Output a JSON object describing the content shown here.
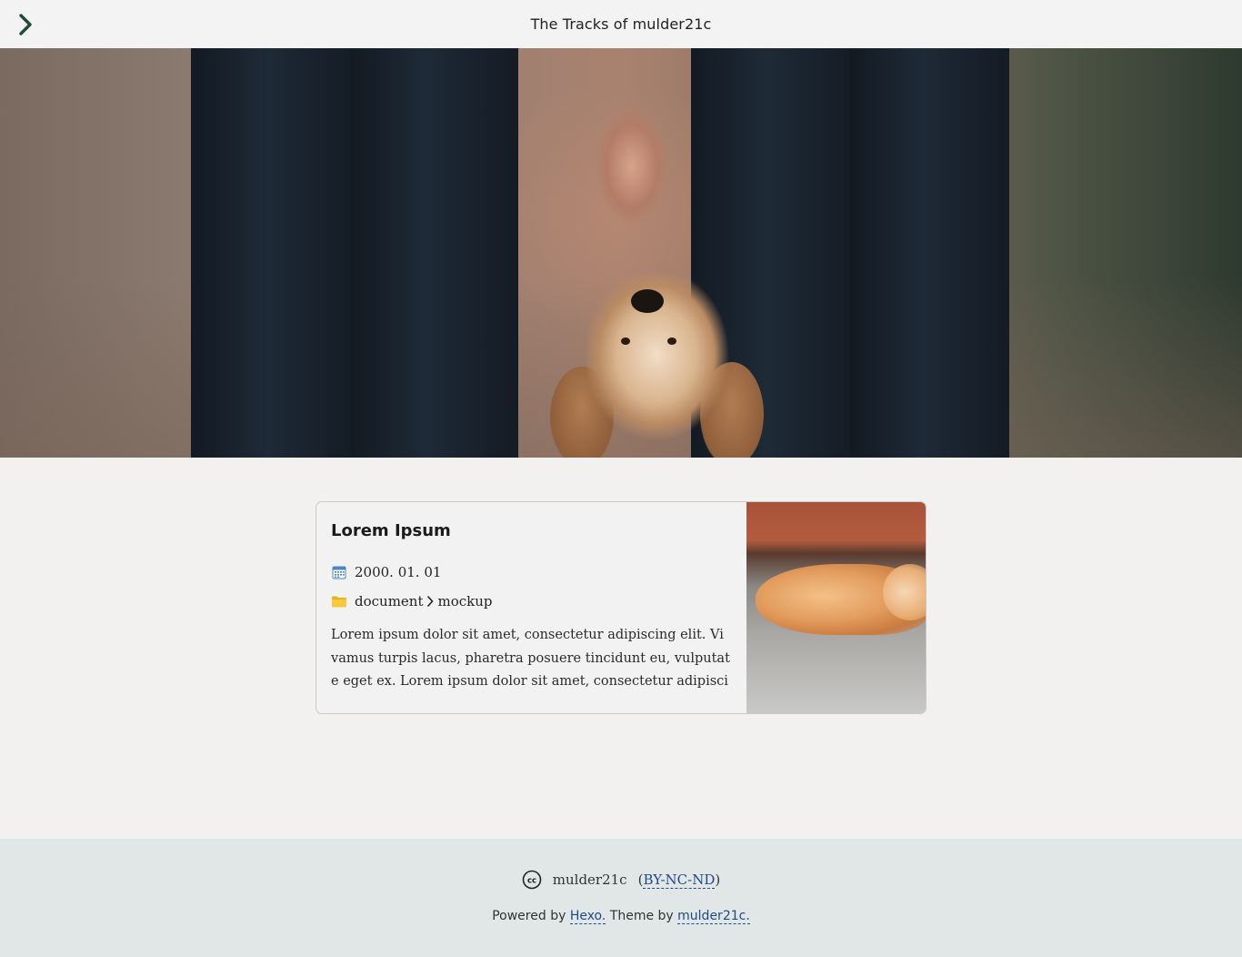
{
  "header": {
    "site_title": "The Tracks of mulder21c",
    "menu_icon": "chevron-right-icon"
  },
  "hero": {
    "image_alt": "Two people holding hands with a golden retriever looking up"
  },
  "post_card": {
    "title": "Lorem Ipsum",
    "date_icon": "calendar-icon",
    "date": "2000. 01. 01",
    "category_icon": "folder-icon",
    "categories": [
      "document",
      "mockup"
    ],
    "excerpt": "Lorem ipsum dolor sit amet, consectetur adipiscing elit. Vivamus turpis lacus, pharetra posuere tincidunt eu, vulputate eget ex. Lorem ipsum dolor sit amet, consectetur adipiscin…",
    "thumbnail_alt": "Sleeping orange kitten"
  },
  "footer": {
    "author": "mulder21c",
    "license_open": "(",
    "license_label": "BY-NC-ND",
    "license_close": ")",
    "powered_prefix": "Powered by ",
    "powered_link": "Hexo.",
    "theme_prefix": " Theme by ",
    "theme_link": "mulder21c."
  },
  "colors": {
    "page_bg": "#f2f1f0",
    "footer_bg": "#e1e6e6",
    "link": "#1f4a8a",
    "menu_icon": "#1e4d36"
  }
}
